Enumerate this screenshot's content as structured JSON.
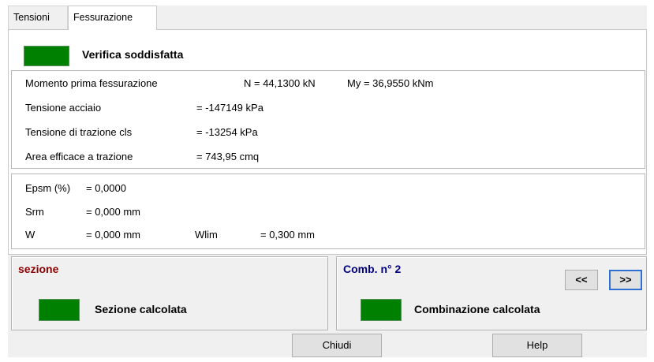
{
  "tabs": [
    {
      "label": "Tensioni"
    },
    {
      "label": "Fessurazione"
    }
  ],
  "status": {
    "label": "Verifica soddisfatta",
    "color": "#008000"
  },
  "group1": {
    "momento_label": "Momento prima fessurazione",
    "momento_n": "N = 44,1300 kN",
    "momento_my": "My = 36,9550 kNm",
    "acciaio_label": "Tensione acciaio",
    "acciaio_value": "= -147149 kPa",
    "cls_label": "Tensione di trazione cls",
    "cls_value": "= -13254 kPa",
    "area_label": "Area efficace a trazione",
    "area_value": "= 743,95 cmq"
  },
  "group2": {
    "epsm_label": "Epsm (%)",
    "epsm_value": "= 0,0000",
    "srm_label": "Srm",
    "srm_value": "= 0,000 mm",
    "w_label": "W",
    "w_value": "= 0,000 mm",
    "wlim_label": "Wlim",
    "wlim_value": "= 0,300 mm"
  },
  "sezione": {
    "title": "sezione",
    "title_color": "#8b0000",
    "label": "Sezione calcolata"
  },
  "combinazione": {
    "title": "Comb. n° 2",
    "title_color": "#00007f",
    "label": "Combinazione calcolata",
    "prev": "<<",
    "next": ">>"
  },
  "buttons": {
    "close": "Chiudi",
    "help": "Help"
  }
}
